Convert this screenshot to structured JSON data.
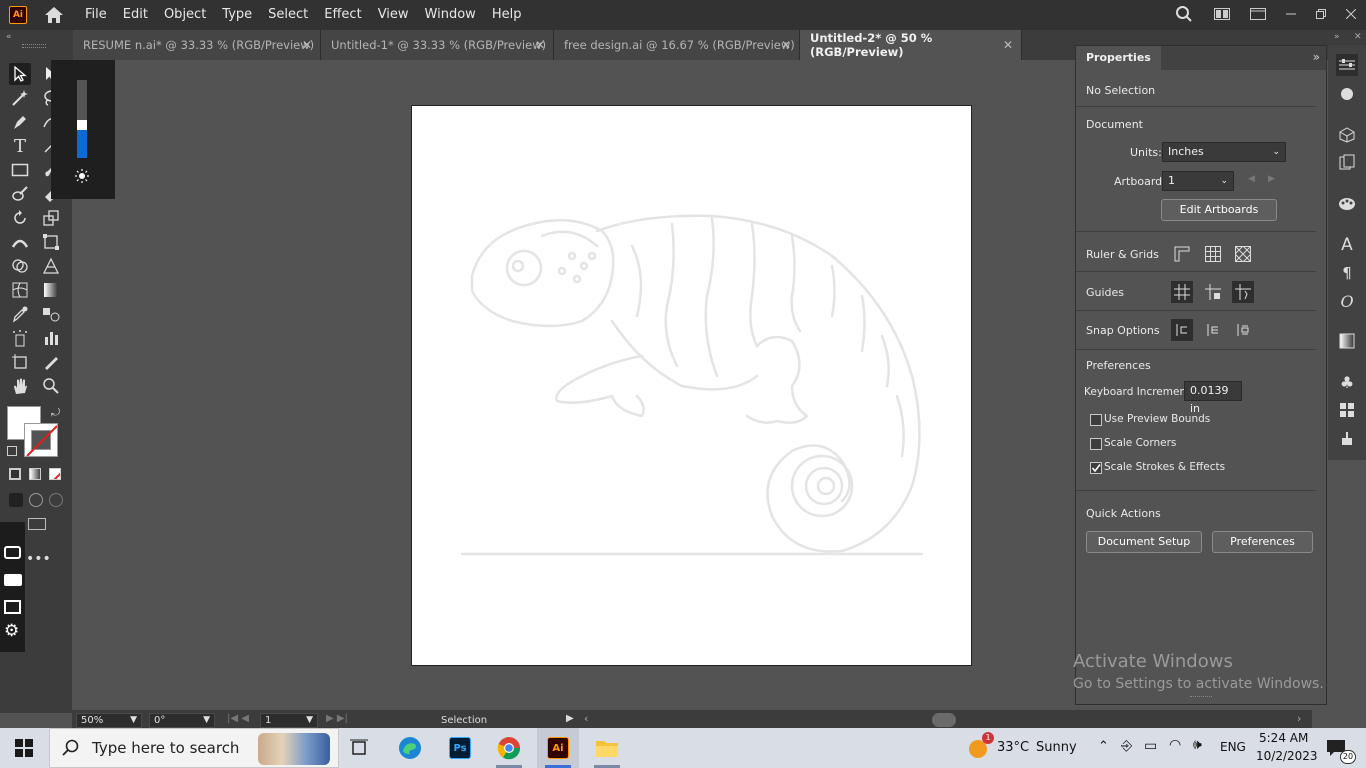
{
  "app": {
    "logo_text": "Ai",
    "menu": [
      "File",
      "Edit",
      "Object",
      "Type",
      "Select",
      "Effect",
      "View",
      "Window",
      "Help"
    ]
  },
  "tabs": [
    {
      "label": "RESUME n.ai* @ 33.33 % (RGB/Preview)",
      "close": "✕"
    },
    {
      "label": "Untitled-1* @ 33.33 % (RGB/Preview)",
      "close": "✕"
    },
    {
      "label": "free design.ai @ 16.67 % (RGB/Preview)",
      "close": "✕"
    },
    {
      "label": "Untitled-2* @ 50 % (RGB/Preview)",
      "close": "✕"
    }
  ],
  "properties": {
    "title": "Properties",
    "selection": "No Selection",
    "document_label": "Document",
    "units_label": "Units:",
    "units_value": "Inches",
    "artboard_label": "Artboard:",
    "artboard_value": "1",
    "edit_artboards": "Edit Artboards",
    "ruler_grids": "Ruler & Grids",
    "guides": "Guides",
    "snap_options": "Snap Options",
    "preferences_label": "Preferences",
    "keyboard_increment_label": "Keyboard Increment:",
    "keyboard_increment_value": "0.0139 in",
    "use_preview_bounds": "Use Preview Bounds",
    "scale_corners": "Scale Corners",
    "scale_strokes": "Scale Strokes & Effects",
    "quick_actions": "Quick Actions",
    "document_setup": "Document Setup",
    "preferences_button": "Preferences"
  },
  "checkboxes": {
    "use_preview_bounds": false,
    "scale_corners": false,
    "scale_strokes": true
  },
  "status": {
    "zoom": "50%",
    "rotation": "0°",
    "artboard": "1",
    "tool": "Selection"
  },
  "watermark": {
    "line1": "Activate Windows",
    "line2": "Go to Settings to activate Windows."
  },
  "taskbar": {
    "search_placeholder": "Type here to search",
    "weather_temp": "33°C",
    "weather_cond": "Sunny",
    "weather_badge": "1",
    "language": "ENG",
    "time": "5:24 AM",
    "date": "10/2/2023",
    "notifications": "20"
  },
  "colors": {
    "accent": "#0a6bd6",
    "panel": "#535353",
    "menubar": "#323232"
  }
}
